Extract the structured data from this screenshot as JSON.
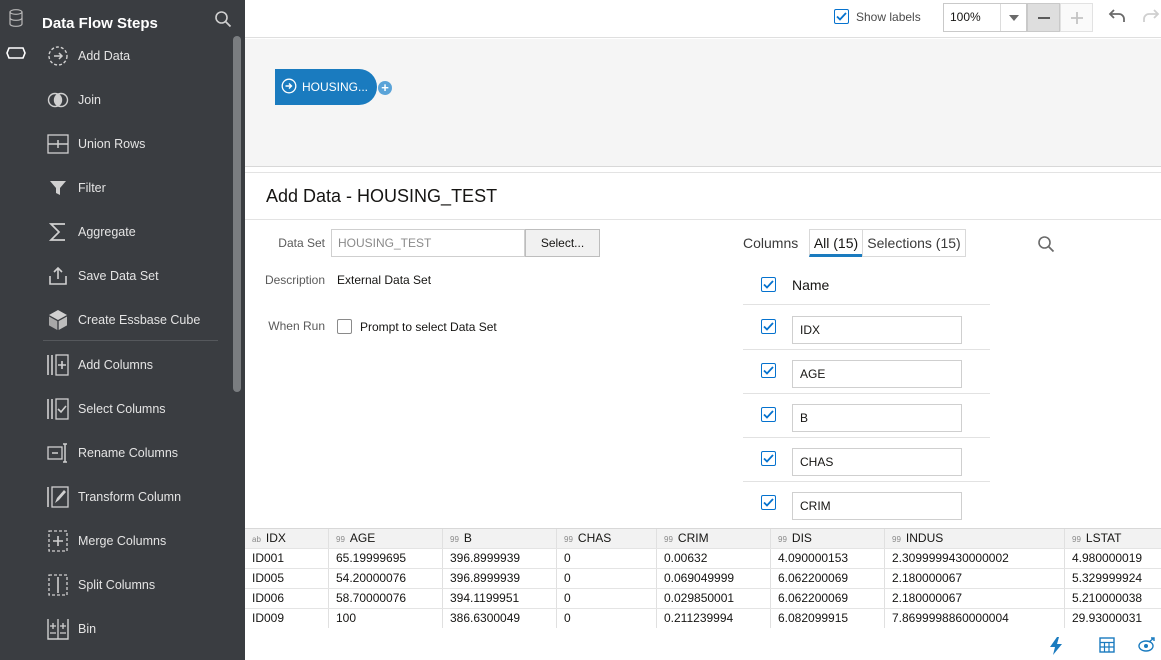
{
  "steps_panel": {
    "title": "Data Flow Steps",
    "items": [
      {
        "label": "Add Data",
        "icon": "add-data-icon"
      },
      {
        "label": "Join",
        "icon": "join-icon"
      },
      {
        "label": "Union Rows",
        "icon": "union-rows-icon"
      },
      {
        "label": "Filter",
        "icon": "filter-icon"
      },
      {
        "label": "Aggregate",
        "icon": "aggregate-icon"
      },
      {
        "label": "Save Data Set",
        "icon": "save-data-set-icon"
      },
      {
        "label": "Create Essbase Cube",
        "icon": "cube-icon"
      },
      {
        "label": "Add Columns",
        "icon": "add-columns-icon"
      },
      {
        "label": "Select Columns",
        "icon": "select-columns-icon"
      },
      {
        "label": "Rename Columns",
        "icon": "rename-columns-icon"
      },
      {
        "label": "Transform Column",
        "icon": "transform-column-icon"
      },
      {
        "label": "Merge Columns",
        "icon": "merge-columns-icon"
      },
      {
        "label": "Split Columns",
        "icon": "split-columns-icon"
      },
      {
        "label": "Bin",
        "icon": "bin-icon"
      }
    ]
  },
  "toolbar": {
    "show_labels": "Show labels",
    "zoom": "100%"
  },
  "canvas": {
    "node_label": "HOUSING..."
  },
  "detail": {
    "title": "Add Data - HOUSING_TEST",
    "dataset_label": "Data Set",
    "dataset_value": "HOUSING_TEST",
    "select_button": "Select...",
    "description_label": "Description",
    "description_value": "External Data Set",
    "when_run_label": "When Run",
    "prompt_label": "Prompt to select Data Set"
  },
  "columns": {
    "label": "Columns",
    "tab_all": "All (15)",
    "tab_selections": "Selections (15)",
    "name_header": "Name",
    "rows": [
      "IDX",
      "AGE",
      "B",
      "CHAS",
      "CRIM"
    ]
  },
  "table": {
    "headers": [
      {
        "type": "ab",
        "name": "IDX"
      },
      {
        "type": "99",
        "name": "AGE"
      },
      {
        "type": "99",
        "name": "B"
      },
      {
        "type": "99",
        "name": "CHAS"
      },
      {
        "type": "99",
        "name": "CRIM"
      },
      {
        "type": "99",
        "name": "DIS"
      },
      {
        "type": "99",
        "name": "INDUS"
      },
      {
        "type": "99",
        "name": "LSTAT"
      }
    ],
    "rows": [
      [
        "ID001",
        "65.19999695",
        "396.8999939",
        "0",
        "0.00632",
        "4.090000153",
        "2.3099999430000002",
        "4.980000019"
      ],
      [
        "ID005",
        "54.20000076",
        "396.8999939",
        "0",
        "0.069049999",
        "6.062200069",
        "2.180000067",
        "5.329999924"
      ],
      [
        "ID006",
        "58.70000076",
        "394.1199951",
        "0",
        "0.029850001",
        "6.062200069",
        "2.180000067",
        "5.210000038"
      ],
      [
        "ID009",
        "100",
        "386.6300049",
        "0",
        "0.211239994",
        "6.082099915",
        "7.8699998860000004",
        "29.93000031"
      ]
    ]
  },
  "colors": {
    "sidebar_bg": "#3a3d41",
    "accent": "#1a7bbf"
  }
}
